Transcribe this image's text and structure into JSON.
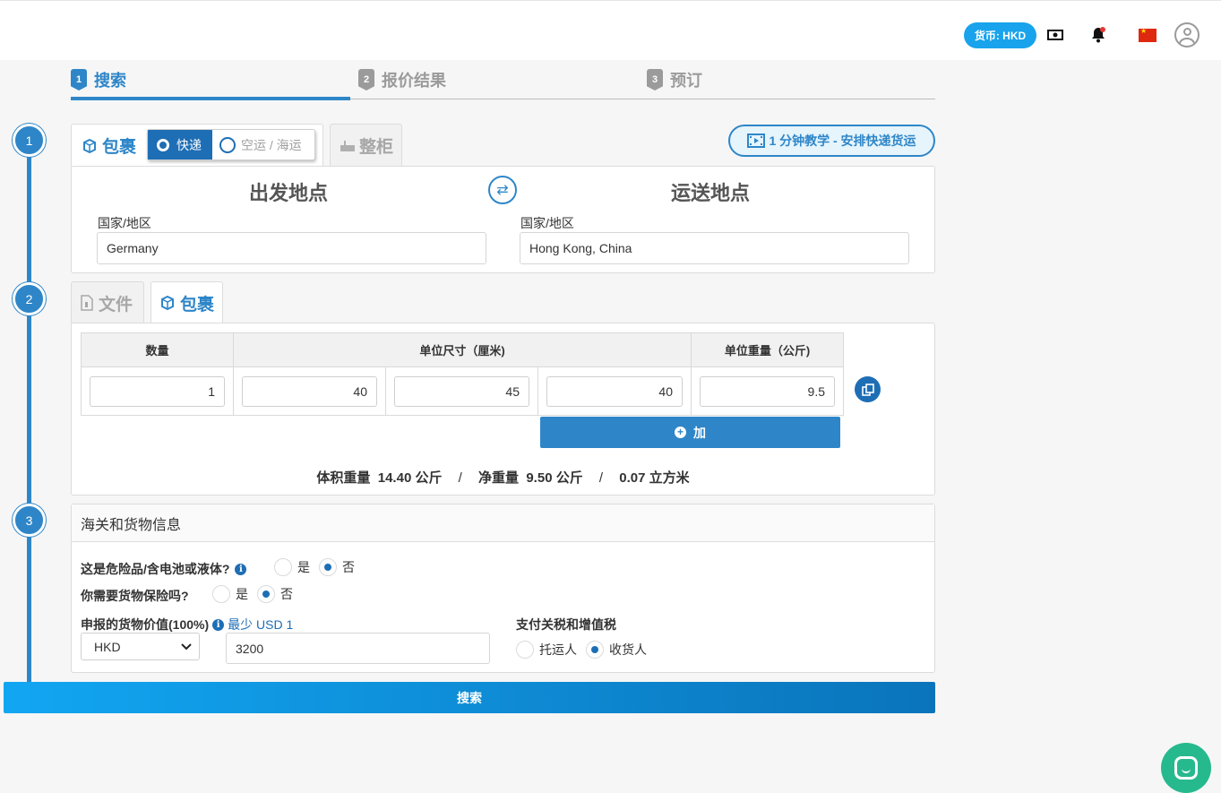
{
  "header": {
    "currency_label": "货币: HKD",
    "icons": [
      "money-icon",
      "bell-icon",
      "china-flag-icon",
      "user-avatar-icon"
    ]
  },
  "steps": [
    {
      "num": "1",
      "label": "搜索",
      "active": true
    },
    {
      "num": "2",
      "label": "报价结果",
      "active": false
    },
    {
      "num": "3",
      "label": "预订",
      "active": false
    }
  ],
  "timeline": [
    "1",
    "2",
    "3"
  ],
  "shipment": {
    "tab_parcel": "包裹",
    "mode_express": "快递",
    "mode_air_sea": "空运 / 海运",
    "tab_container": "整柜",
    "tutorial_label": "1 分钟教学 - 安排快递货运",
    "origin_title": "出发地点",
    "destination_title": "运送地点",
    "origin_label": "国家/地区",
    "origin_value": "Germany",
    "destination_label": "国家/地区",
    "destination_value": "Hong Kong, China"
  },
  "package": {
    "tab_document": "文件",
    "tab_parcel": "包裹",
    "headers": {
      "quantity": "数量",
      "dimensions": "单位尺寸（厘米)",
      "weight": "单位重量（公斤)"
    },
    "row": {
      "quantity": "1",
      "length": "40",
      "width": "45",
      "height": "40",
      "weight": "9.5"
    },
    "add_label": "加",
    "summary": {
      "vol_label": "体积重量",
      "vol_value": "14.40 公斤",
      "net_label": "净重量",
      "net_value": "9.50 公斤",
      "cbm_value": "0.07 立方米",
      "sep": "/"
    }
  },
  "customs": {
    "title": "海关和货物信息",
    "dangerous_q": "这是危险品/含电池或液体?",
    "insurance_q": "你需要货物保险吗?",
    "yes": "是",
    "no": "否",
    "declared_label": "申报的货物价值(100%)",
    "min_note": "最少 USD 1",
    "currency_value": "HKD",
    "declared_value": "3200",
    "duty_label": "支付关税和增值税",
    "shipper": "托运人",
    "consignee": "收货人"
  },
  "search_label": "搜索",
  "colors": {
    "primary": "#2e86c8",
    "dark_primary": "#1e6eb5",
    "pill": "#18a3ec",
    "chat": "#27b98e"
  }
}
